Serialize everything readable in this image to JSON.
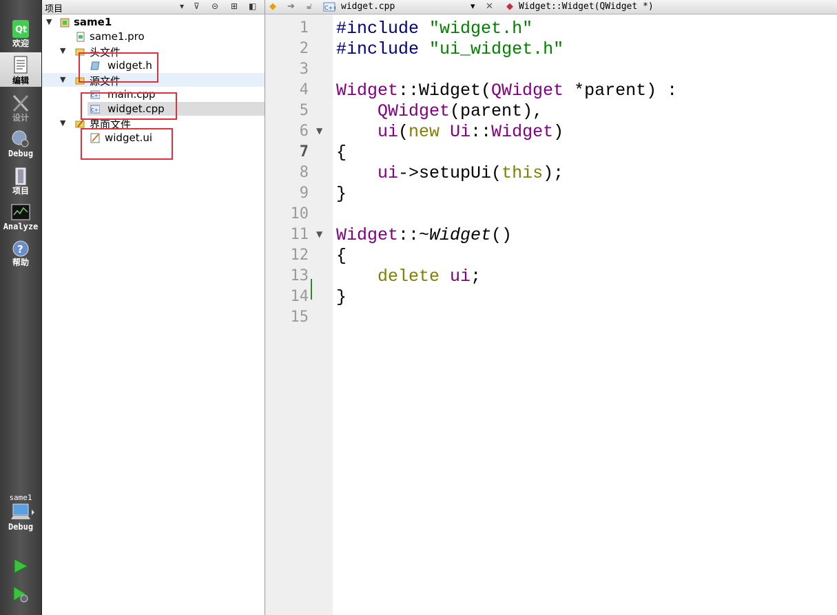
{
  "modes": [
    {
      "label": "欢迎",
      "icon": "qt-logo-icon"
    },
    {
      "label": "编辑",
      "icon": "edit-document-icon",
      "active": true
    },
    {
      "label": "设计",
      "icon": "design-tools-icon",
      "dim": true
    },
    {
      "label": "Debug",
      "icon": "debug-bug-icon"
    },
    {
      "label": "项目",
      "icon": "project-icon"
    },
    {
      "label": "Analyze",
      "icon": "analyze-monitor-icon"
    },
    {
      "label": "帮助",
      "icon": "help-icon"
    }
  ],
  "kit": {
    "project": "same1",
    "build": "Debug"
  },
  "project_panel": {
    "title": "项目",
    "tree": [
      {
        "label": "same1",
        "icon": "qt-project-icon",
        "bold": true
      },
      {
        "label": "same1.pro",
        "icon": "pro-file-icon"
      },
      {
        "label": "头文件",
        "icon": "folder-icon"
      },
      {
        "label": "widget.h",
        "icon": "header-file-icon"
      },
      {
        "label": "源文件",
        "icon": "folder-icon"
      },
      {
        "label": "main.cpp",
        "icon": "cpp-file-icon"
      },
      {
        "label": "widget.cpp",
        "icon": "cpp-file-icon"
      },
      {
        "label": "界面文件",
        "icon": "folder-icon"
      },
      {
        "label": "widget.ui",
        "icon": "ui-file-icon"
      }
    ]
  },
  "editor": {
    "file": "widget.cpp",
    "symbol": "Widget::Widget(QWidget *)",
    "line_numbers": [
      "1",
      "2",
      "3",
      "4",
      "5",
      "6",
      "7",
      "8",
      "9",
      "10",
      "11",
      "12",
      "13",
      "14",
      "15"
    ],
    "current_line": "7"
  },
  "colors": {
    "highlight": "#e0303a",
    "type": "#800080",
    "string": "#008000",
    "keyword": "#808000"
  }
}
